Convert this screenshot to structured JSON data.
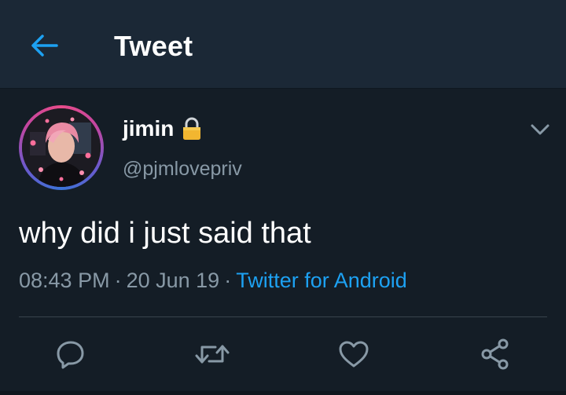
{
  "header": {
    "title": "Tweet",
    "back_icon": "back-arrow-icon",
    "accent": "#1da1f2"
  },
  "tweet": {
    "author": {
      "display_name": "jimin",
      "handle": "@pjmlovepriv",
      "protected_icon": "lock-icon"
    },
    "text": "why did i just said that",
    "time": "08:43 PM",
    "date": "20 Jun 19",
    "separator": "·",
    "source": "Twitter for Android"
  },
  "actions": [
    {
      "name": "reply",
      "icon": "reply-icon"
    },
    {
      "name": "retweet",
      "icon": "retweet-icon"
    },
    {
      "name": "like",
      "icon": "heart-icon"
    },
    {
      "name": "share",
      "icon": "share-icon"
    }
  ],
  "colors": {
    "background": "#141d26",
    "header": "#1b2836",
    "secondary_text": "#8899a6",
    "link": "#1da1f2"
  }
}
